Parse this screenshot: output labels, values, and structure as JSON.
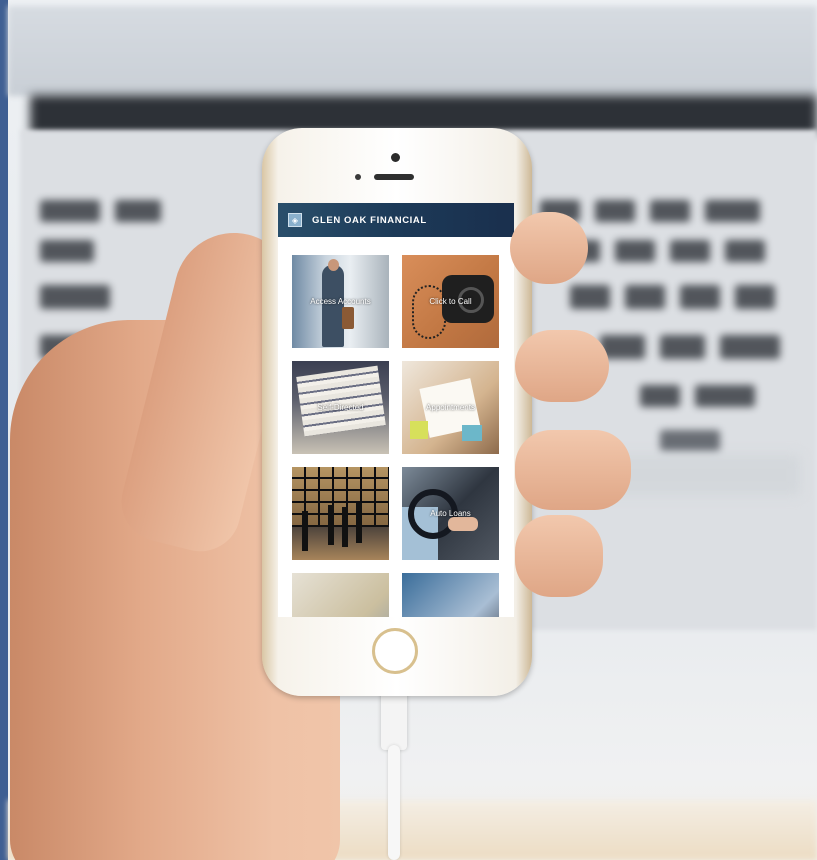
{
  "app": {
    "title": "GLEN OAK FINANCIAL",
    "logo_icon": "logo-icon"
  },
  "tiles": [
    {
      "label": "Access Accounts"
    },
    {
      "label": "Click to Call"
    },
    {
      "label": "Self-Directed"
    },
    {
      "label": "Appointments"
    },
    {
      "label": ""
    },
    {
      "label": "Auto Loans"
    },
    {
      "label": ""
    },
    {
      "label": ""
    }
  ],
  "colors": {
    "header_start": "#2a4f6b",
    "header_end": "#1a2f4d",
    "side_stripe": "#3f5f93",
    "phone_gold": "#d8c08e"
  }
}
